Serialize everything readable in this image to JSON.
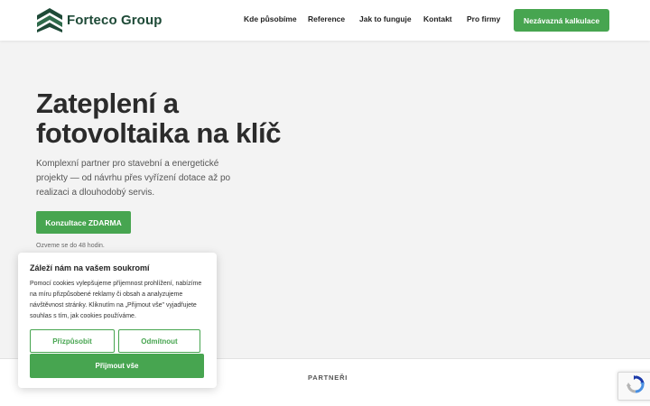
{
  "header": {
    "logo_text": "Forteco Group",
    "nav": [
      {
        "label": "Kde působíme"
      },
      {
        "label": "Reference"
      },
      {
        "label": "Jak to funguje"
      },
      {
        "label": "Kontakt"
      },
      {
        "label": "Pro firmy"
      }
    ],
    "cta_label": "Nezávazná kalkulace"
  },
  "hero": {
    "title_line1": "Zateplení a",
    "title_line2": "fotovoltaika na klíč",
    "subtitle": "Komplexní partner pro stavební a energetické projekty — od návrhu přes vyřízení dotace až po realizaci a dlouhodobý servis.",
    "button_label": "Konzultace ZDARMA",
    "note": "Ozveme se do 48 hodin."
  },
  "partners": {
    "label": "PARTNEŘI"
  },
  "cookie": {
    "title": "Záleží nám na vašem soukromí",
    "text": "Pomocí cookies vylepšujeme příjemnost prohlížení, nabízíme na míru přizpůsobené reklamy či obsah a analyzujeme návštěvnost stránky. Kliknutím na „Přijmout vše\" vyjadřujete souhlas s tím, jak cookies používáme.",
    "customize_label": "Přizpůsobit",
    "reject_label": "Odmítnout",
    "accept_label": "Přijmout vše"
  },
  "colors": {
    "accent": "#47a550",
    "logo_dark": "#1e4a37",
    "background": "#f3f3f3"
  },
  "icons": {
    "logo": "forteco-roof-logo-icon",
    "recaptcha": "recaptcha-icon"
  }
}
